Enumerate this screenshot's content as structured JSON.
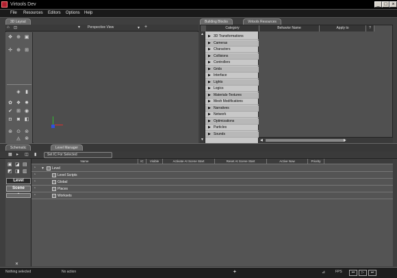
{
  "window": {
    "title": "Virtools Dev",
    "min": "_",
    "max": "□",
    "close": "×"
  },
  "menu": [
    {
      "label": "File"
    },
    {
      "label": "Resources"
    },
    {
      "label": "Editors"
    },
    {
      "label": "Options"
    },
    {
      "label": "Help"
    }
  ],
  "layout3d": {
    "tab": "3D Layout",
    "camera_label": "Perspective View",
    "camera_menu": "▼",
    "ortho_btn": "+"
  },
  "building": {
    "tabs": [
      "Building Blocks",
      "Virtools Resources"
    ],
    "columns": [
      "Category",
      "Behavior Name",
      "Apply to",
      "?"
    ],
    "categories": [
      "3D Transformations",
      "Cameras",
      "Characters",
      "Collisions",
      "Controllers",
      "Grids",
      "Interface",
      "Lights",
      "Logics",
      "Materials-Textures",
      "Mesh Modifications",
      "Narratives",
      "Network",
      "Optimizations",
      "Particles",
      "Sounds"
    ]
  },
  "lower_tabs": [
    "Schematic",
    "Level Manager"
  ],
  "set_ic_label": "Set IC For Selected",
  "level_manager": {
    "columns": [
      "Name",
      "IC",
      "Visible",
      "Activate At Scene Start",
      "Reset At Scene Start",
      "Active Now",
      "Priority"
    ],
    "rows": [
      {
        "label": "Level",
        "indent": 0
      },
      {
        "label": "Level Scripts",
        "indent": 1
      },
      {
        "label": "Global",
        "indent": 1
      },
      {
        "label": "Places",
        "indent": 1
      },
      {
        "label": "Worksets",
        "indent": 1
      }
    ],
    "side_buttons": {
      "level": "Level",
      "scene": "Scene",
      "up": "⌃"
    }
  },
  "status": {
    "left": "Nothing selected",
    "action": "No action",
    "fps_label": "FPS",
    "buttons": [
      "⏮",
      "▷",
      "⏭"
    ]
  }
}
